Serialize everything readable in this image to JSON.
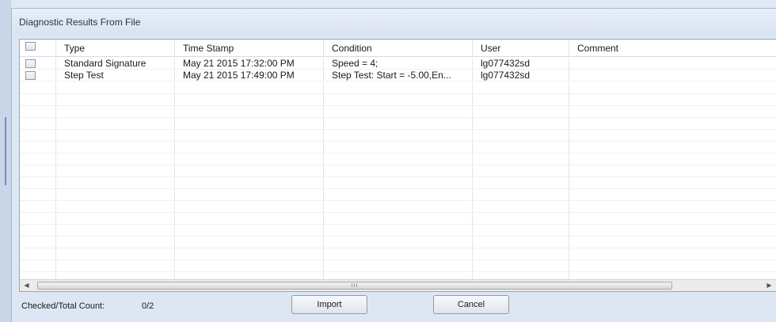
{
  "dialog": {
    "title": "Diagnostic Results From File"
  },
  "grid": {
    "columns": [
      "",
      "Type",
      "Time Stamp",
      "Condition",
      "User",
      "Comment"
    ],
    "rows": [
      {
        "type": "Standard Signature",
        "timestamp": "May 21 2015 17:32:00 PM",
        "condition": "Speed = 4;",
        "user": "lg077432sd",
        "comment": ""
      },
      {
        "type": "Step Test",
        "timestamp": "May 21 2015 17:49:00 PM",
        "condition": "Step Test:  Start = -5.00,En...",
        "user": "lg077432sd",
        "comment": ""
      }
    ],
    "scroll_grip": "III"
  },
  "footer": {
    "count_label": "Checked/Total Count:",
    "count_value": "0/2",
    "import_label": "Import",
    "cancel_label": "Cancel"
  }
}
